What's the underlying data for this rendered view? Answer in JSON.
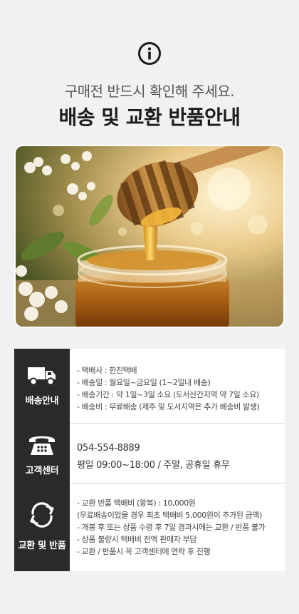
{
  "header": {
    "info_icon": "info-circle-icon",
    "subtitle": "구매전 반드시 확인해 주세요.",
    "title": "배송 및 교환 반품안내"
  },
  "hero": {
    "image": "honey-dipper-jar-photo"
  },
  "sections": {
    "shipping": {
      "icon": "truck-icon",
      "label": "배송안내",
      "lines": [
        "-  택배사 : 한진택배",
        "-  배송일 : 월요일~금요일 (1~2일내 배송)",
        "-  배송기간 : 약 1일~3일 소요 (도서산간지역 약 7일 소요)",
        "-  배송비 : 무료배송 (제주 및 도서지역은 추가 배송비 발생)"
      ]
    },
    "support": {
      "icon": "telephone-icon",
      "label": "고객센터",
      "phone": "054-554-8889",
      "hours": "평일 09:00~18:00 / 주말, 공휴일 휴무"
    },
    "returns": {
      "icon": "refresh-cycle-icon",
      "label": "교환 및 반품",
      "lines": [
        "- 교환 반품 택배비 (왕복) : 10,000원",
        "(무료배송이었을 경우 최초 택배비 5,000원이 추가된 금액)",
        "- 개봉 후 또는 상품 수령 후 7일 경과시에는 교환 / 반품 불가",
        "- 상품 불량시 택배비 전액 판매자 부담",
        "- 교환 / 반품시 꼭 고객센터에 연락 후 진행"
      ]
    }
  },
  "colors": {
    "background": "#f1f1f1",
    "label_bg": "#2a2a2a",
    "title": "#1c1c1c",
    "honey": "#e0a126"
  }
}
